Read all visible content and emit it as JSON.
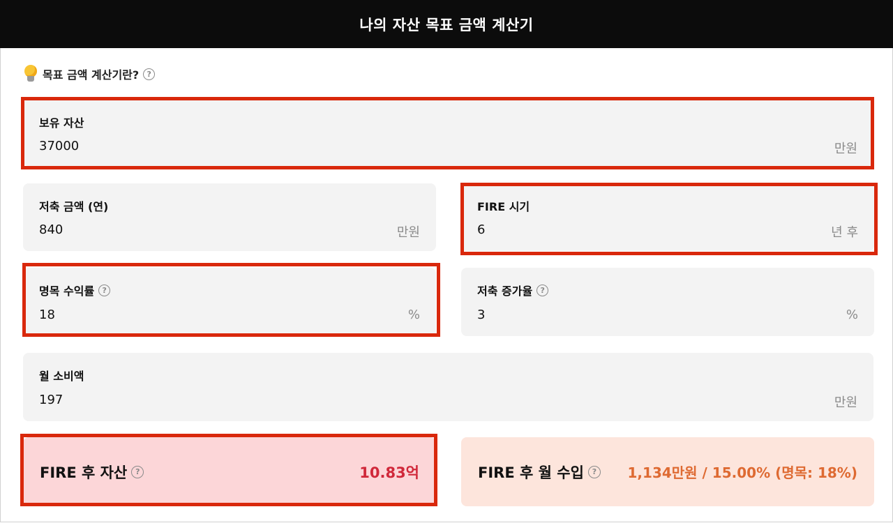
{
  "header": {
    "title": "나의 자산 목표 금액 계산기"
  },
  "intro": {
    "icon": "lightbulb-icon",
    "text": "목표 금액 계산기란?"
  },
  "fields": {
    "assets": {
      "label": "보유 자산",
      "value": "37000",
      "unit": "만원"
    },
    "savings": {
      "label": "저축 금액 (연)",
      "value": "840",
      "unit": "만원"
    },
    "fire_timing": {
      "label": "FIRE 시기",
      "value": "6",
      "unit": "년 후"
    },
    "nominal_return": {
      "label": "명목 수익률",
      "value": "18",
      "unit": "%"
    },
    "savings_growth": {
      "label": "저축 증가율",
      "value": "3",
      "unit": "%"
    },
    "monthly_spend": {
      "label": "월 소비액",
      "value": "197",
      "unit": "만원"
    }
  },
  "results": {
    "fire_assets": {
      "label": "FIRE 후 자산",
      "value": "10.83억",
      "color": "#d0283a",
      "bg": "#fcd6d8"
    },
    "fire_income": {
      "label": "FIRE 후 월 수입",
      "value": "1,134만원 / 15.00% (명목: 18%)",
      "color": "#de6a32",
      "bg": "#fde5dc"
    }
  },
  "highlight_color": "#d9280c"
}
